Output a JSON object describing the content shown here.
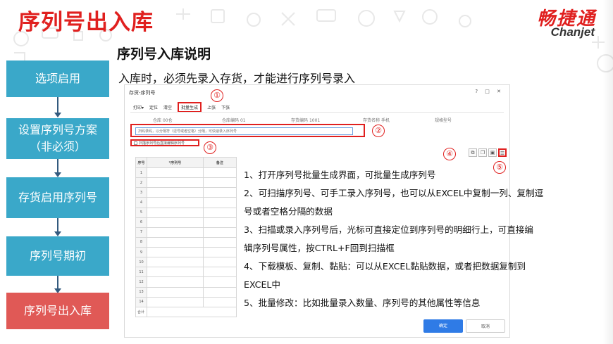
{
  "slide": {
    "title": "序列号出入库",
    "logo_cn": "畅捷通",
    "logo_en": "Chanjet",
    "subtitle": "序列号入库说明",
    "intro": "入库时，必须先录入存货，才能进行序列号录入"
  },
  "steps": [
    {
      "label": "选项启用"
    },
    {
      "label": "设置序列号方案（非必须）"
    },
    {
      "label": "存货启用序列号"
    },
    {
      "label": "序列号期初"
    },
    {
      "label": "序列号出入库"
    }
  ],
  "dialog": {
    "title": "存货-序列号",
    "window_buttons": "? □ ✕",
    "toolbar": [
      "打印▾",
      "定位",
      "清空",
      "批量生成",
      "上张",
      "下张"
    ],
    "fields": [
      {
        "label": "仓库",
        "value": "00仓"
      },
      {
        "label": "仓库编码",
        "value": "01"
      },
      {
        "label": "存货编码",
        "value": "1001"
      },
      {
        "label": "存货名称",
        "value": "手机"
      },
      {
        "label": "规格型号",
        "value": ""
      }
    ],
    "scan_placeholder": "扫码录码，以分隔符（逗号或者空格）分隔，可快速录入序列号",
    "checkbox_label": "扫描序列号后直接编辑序列号",
    "table": {
      "headers": [
        "序号",
        "*序列号",
        "备注"
      ],
      "rows": [
        "1",
        "2",
        "3",
        "4",
        "5",
        "6",
        "7",
        "8",
        "9",
        "10",
        "11",
        "12",
        "13",
        "14"
      ],
      "total_label": "合计"
    },
    "ok_label": "确定",
    "cancel_label": "取消"
  },
  "callouts": [
    "①",
    "②",
    "③",
    "④",
    "⑤"
  ],
  "description": [
    "1、打开序列号批量生成界面，可批量生成序列号",
    "2、可扫描序列号、可手工录入序列号，也可以从EXCEL中复制一列、复制逗",
    "号或者空格分隔的数据",
    "3、扫描或录入序列号后，光标可直接定位到序列号的明细行上，可直接编",
    "辑序列号属性，按CTRL+F回到扫描框",
    "4、下载模板、复制、黏贴：可以从EXCEL黏贴数据，或者把数据复制到",
    "EXCEL中",
    "5、批量修改：比如批量录入数量、序列号的其他属性等信息"
  ],
  "colors": {
    "title_red": "#e0201f",
    "step_blue": "#3aa8c9",
    "step_active": "#e05956",
    "ok_blue": "#2f7be6"
  }
}
